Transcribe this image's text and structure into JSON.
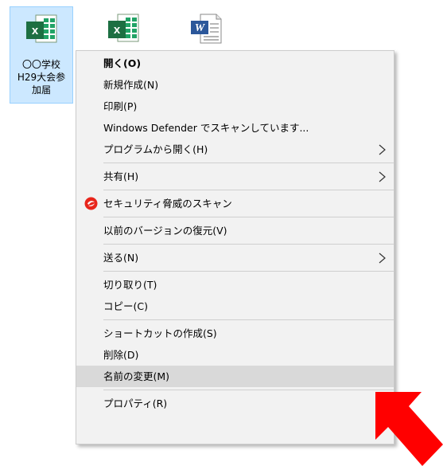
{
  "desktop_icons": [
    {
      "caption": "〇〇学校\nH29大会参\n加届",
      "type": "excel-icon",
      "selected": true
    },
    {
      "caption": "",
      "type": "excel-icon",
      "selected": false
    },
    {
      "caption": "",
      "type": "word-icon",
      "selected": false
    }
  ],
  "context_menu": {
    "items": [
      {
        "label": "開く(O)"
      },
      {
        "label": "新規作成(N)"
      },
      {
        "label": "印刷(P)"
      },
      {
        "label": "Windows Defender でスキャンしています..."
      },
      {
        "label": "プログラムから開く(H)"
      },
      {
        "label": "共有(H)"
      },
      {
        "label": "セキュリティ脅威のスキャン"
      },
      {
        "label": "以前のバージョンの復元(V)"
      },
      {
        "label": "送る(N)"
      },
      {
        "label": "切り取り(T)"
      },
      {
        "label": "コピー(C)"
      },
      {
        "label": "ショートカットの作成(S)"
      },
      {
        "label": "削除(D)"
      },
      {
        "label": "名前の変更(M)"
      },
      {
        "label": "プロパティ(R)"
      }
    ]
  },
  "colors": {
    "selection_bg": "#cce8ff",
    "menu_bg": "#f2f2f2",
    "hover_bg": "#d9d9d9",
    "excel_green": "#1d6f42",
    "word_blue": "#2b579a",
    "arrow_red": "#ff0000"
  }
}
